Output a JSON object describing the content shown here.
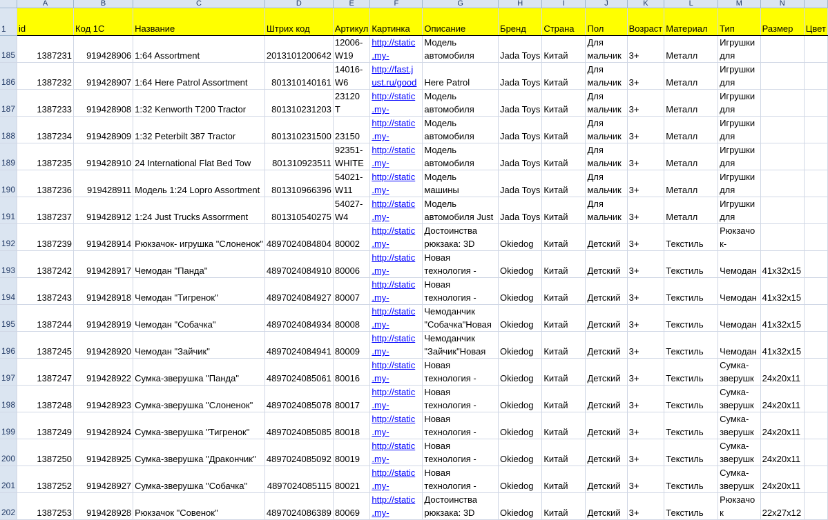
{
  "columns": [
    "A",
    "B",
    "C",
    "D",
    "E",
    "F",
    "G",
    "H",
    "I",
    "J",
    "K",
    "L",
    "M",
    "N"
  ],
  "header_row": {
    "row_number": "1",
    "cells": [
      "id",
      "Код 1С",
      "Название",
      "Штрих код",
      "Артикул",
      "Картинка",
      "Описание",
      "Бренд",
      "Страна",
      "Пол",
      "Возраст",
      "Материал",
      "Тип",
      "Размер",
      "Цвет"
    ]
  },
  "rows": [
    {
      "n": "185",
      "id": "1387231",
      "code": "919428906",
      "name": "1:64 Assortment",
      "barcode": "2013101200642",
      "art": [
        "12006-",
        "W19"
      ],
      "pic": [
        "http://static",
        ".my-"
      ],
      "desc": [
        "Модель",
        "автомобиля"
      ],
      "brand": "Jada Toys",
      "country": "Китай",
      "sex": [
        "Для",
        "мальчик"
      ],
      "age": "3+",
      "mat": "Металл",
      "type": [
        "Игрушки",
        "для"
      ],
      "size": ""
    },
    {
      "n": "186",
      "id": "1387232",
      "code": "919428907",
      "name": "1:64 Here Patrol Assortment",
      "barcode": "801310140161",
      "art": [
        "14016-",
        "W6"
      ],
      "pic": [
        "http://fast.j",
        "ust.ru/good"
      ],
      "desc": [
        "",
        "Here Patrol"
      ],
      "brand": "Jada Toys",
      "country": "Китай",
      "sex": [
        "Для",
        "мальчик"
      ],
      "age": "3+",
      "mat": "Металл",
      "type": [
        "Игрушки",
        "для"
      ],
      "size": ""
    },
    {
      "n": "187",
      "id": "1387233",
      "code": "919428908",
      "name": "1:32 Kenworth T200 Tractor",
      "barcode": "801310231203",
      "art": [
        "23120",
        "T"
      ],
      "pic": [
        "http://static",
        ".my-"
      ],
      "desc": [
        "Модель",
        "автомобиля"
      ],
      "brand": "Jada Toys",
      "country": "Китай",
      "sex": [
        "Для",
        "мальчик"
      ],
      "age": "3+",
      "mat": "Металл",
      "type": [
        "Игрушки",
        "для"
      ],
      "size": ""
    },
    {
      "n": "188",
      "id": "1387234",
      "code": "919428909",
      "name": "1:32 Peterbilt 387 Tractor",
      "barcode": "801310231500",
      "art": [
        "",
        "23150"
      ],
      "pic": [
        "http://static",
        ".my-"
      ],
      "desc": [
        "Модель",
        "автомобиля"
      ],
      "brand": "Jada Toys",
      "country": "Китай",
      "sex": [
        "Для",
        "мальчик"
      ],
      "age": "3+",
      "mat": "Металл",
      "type": [
        "Игрушки",
        "для"
      ],
      "size": ""
    },
    {
      "n": "189",
      "id": "1387235",
      "code": "919428910",
      "name": "24 International Flat Bed Tow",
      "barcode": "801310923511",
      "art": [
        "92351-",
        "WHITE"
      ],
      "pic": [
        "http://static",
        ".my-"
      ],
      "desc": [
        "Модель",
        "автомобиля"
      ],
      "brand": "Jada Toys",
      "country": "Китай",
      "sex": [
        "Для",
        "мальчик"
      ],
      "age": "3+",
      "mat": "Металл",
      "type": [
        "Игрушки",
        "для"
      ],
      "size": ""
    },
    {
      "n": "190",
      "id": "1387236",
      "code": "919428911",
      "name": "Модель  1:24 Lopro Assortment",
      "barcode": "801310966396",
      "art": [
        "54021-",
        "W11"
      ],
      "pic": [
        "http://static",
        ".my-"
      ],
      "desc": [
        "Модель",
        "машины"
      ],
      "brand": "Jada Toys",
      "country": "Китай",
      "sex": [
        "Для",
        "мальчик"
      ],
      "age": "3+",
      "mat": "Металл",
      "type": [
        "Игрушки",
        "для"
      ],
      "size": ""
    },
    {
      "n": "191",
      "id": "1387237",
      "code": "919428912",
      "name": "1:24 Just Trucks  Assorrment",
      "barcode": "801310540275",
      "art": [
        "54027-",
        "W4"
      ],
      "pic": [
        "http://static",
        ".my-"
      ],
      "desc": [
        "Модель",
        "автомобиля Just"
      ],
      "brand": "Jada Toys",
      "country": "Китай",
      "sex": [
        "Для",
        "мальчик"
      ],
      "age": "3+",
      "mat": "Металл",
      "type": [
        "Игрушки",
        "для"
      ],
      "size": ""
    },
    {
      "n": "192",
      "id": "1387239",
      "code": "919428914",
      "name": "Рюкзачок- игрушка \"Слоненок\"",
      "barcode": "4897024084804",
      "art": [
        "",
        "80002"
      ],
      "pic": [
        "http://static",
        ".my-"
      ],
      "desc": [
        "Достоинства",
        "рюкзака: 3D"
      ],
      "brand": "Okiedog",
      "country": "Китай",
      "sex": [
        "",
        "Детский"
      ],
      "age": "3+",
      "mat": "Текстиль",
      "type": [
        "Рюкзачо",
        "к-"
      ],
      "size": ""
    },
    {
      "n": "193",
      "id": "1387242",
      "code": "919428917",
      "name": "Чемодан \"Панда\"",
      "barcode": "4897024084910",
      "art": [
        "",
        "80006"
      ],
      "pic": [
        "http://static",
        ".my-"
      ],
      "desc": [
        "Новая",
        "технология -"
      ],
      "brand": "Okiedog",
      "country": "Китай",
      "sex": [
        "",
        "Детский"
      ],
      "age": "3+",
      "mat": "Текстиль",
      "type": [
        "",
        "Чемодан"
      ],
      "size": "41x32x15"
    },
    {
      "n": "194",
      "id": "1387243",
      "code": "919428918",
      "name": "Чемодан \"Тигренок\"",
      "barcode": "4897024084927",
      "art": [
        "",
        "80007"
      ],
      "pic": [
        "http://static",
        ".my-"
      ],
      "desc": [
        "Новая",
        "технология -"
      ],
      "brand": "Okiedog",
      "country": "Китай",
      "sex": [
        "",
        "Детский"
      ],
      "age": "3+",
      "mat": "Текстиль",
      "type": [
        "",
        "Чемодан"
      ],
      "size": "41x32x15"
    },
    {
      "n": "195",
      "id": "1387244",
      "code": "919428919",
      "name": "Чемодан \"Собачка\"",
      "barcode": "4897024084934",
      "art": [
        "",
        "80008"
      ],
      "pic": [
        "http://static",
        ".my-"
      ],
      "desc": [
        "Чемоданчик",
        "\"Собачка\"Новая"
      ],
      "brand": "Okiedog",
      "country": "Китай",
      "sex": [
        "",
        "Детский"
      ],
      "age": "3+",
      "mat": "Текстиль",
      "type": [
        "",
        "Чемодан"
      ],
      "size": "41x32x15"
    },
    {
      "n": "196",
      "id": "1387245",
      "code": "919428920",
      "name": "Чемодан \"Зайчик\"",
      "barcode": "4897024084941",
      "art": [
        "",
        "80009"
      ],
      "pic": [
        "http://static",
        ".my-"
      ],
      "desc": [
        "Чемоданчик",
        "\"Зайчик\"Новая"
      ],
      "brand": "Okiedog",
      "country": "Китай",
      "sex": [
        "",
        "Детский"
      ],
      "age": "3+",
      "mat": "Текстиль",
      "type": [
        "",
        "Чемодан"
      ],
      "size": "41x32x15"
    },
    {
      "n": "197",
      "id": "1387247",
      "code": "919428922",
      "name": "Сумка-зверушка \"Панда\"",
      "barcode": "4897024085061",
      "art": [
        "",
        "80016"
      ],
      "pic": [
        "http://static",
        ".my-"
      ],
      "desc": [
        "Новая",
        "технология -"
      ],
      "brand": "Okiedog",
      "country": "Китай",
      "sex": [
        "",
        "Детский"
      ],
      "age": "3+",
      "mat": "Текстиль",
      "type": [
        "Сумка-",
        "зверушк"
      ],
      "size": "24x20x11"
    },
    {
      "n": "198",
      "id": "1387248",
      "code": "919428923",
      "name": "Сумка-зверушка  \"Слоненок\"",
      "barcode": "4897024085078",
      "art": [
        "",
        "80017"
      ],
      "pic": [
        "http://static",
        ".my-"
      ],
      "desc": [
        "Новая",
        "технология -"
      ],
      "brand": "Okiedog",
      "country": "Китай",
      "sex": [
        "",
        "Детский"
      ],
      "age": "3+",
      "mat": "Текстиль",
      "type": [
        "Сумка-",
        "зверушк"
      ],
      "size": "24x20x11"
    },
    {
      "n": "199",
      "id": "1387249",
      "code": "919428924",
      "name": "Сумка-зверушка  \"Тигренок\"",
      "barcode": "4897024085085",
      "art": [
        "",
        "80018"
      ],
      "pic": [
        "http://static",
        ".my-"
      ],
      "desc": [
        "Новая",
        "технология -"
      ],
      "brand": "Okiedog",
      "country": "Китай",
      "sex": [
        "",
        "Детский"
      ],
      "age": "3+",
      "mat": "Текстиль",
      "type": [
        "Сумка-",
        "зверушк"
      ],
      "size": "24x20x11"
    },
    {
      "n": "200",
      "id": "1387250",
      "code": "919428925",
      "name": "Сумка-зверушка  \"Дракончик\"",
      "barcode": "4897024085092",
      "art": [
        "",
        "80019"
      ],
      "pic": [
        "http://static",
        ".my-"
      ],
      "desc": [
        "Новая",
        "технология -"
      ],
      "brand": "Okiedog",
      "country": "Китай",
      "sex": [
        "",
        "Детский"
      ],
      "age": "3+",
      "mat": "Текстиль",
      "type": [
        "Сумка-",
        "зверушк"
      ],
      "size": "24x20x11"
    },
    {
      "n": "201",
      "id": "1387252",
      "code": "919428927",
      "name": "Сумка-зверушка  \"Собачка\"",
      "barcode": "4897024085115",
      "art": [
        "",
        "80021"
      ],
      "pic": [
        "http://static",
        ".my-"
      ],
      "desc": [
        "Новая",
        "технология -"
      ],
      "brand": "Okiedog",
      "country": "Китай",
      "sex": [
        "",
        "Детский"
      ],
      "age": "3+",
      "mat": "Текстиль",
      "type": [
        "Сумка-",
        "зверушк"
      ],
      "size": "24x20x11"
    },
    {
      "n": "202",
      "id": "1387253",
      "code": "919428928",
      "name": "Рюкзачок \"Совенок\"",
      "barcode": "4897024086389",
      "art": [
        "",
        "80069"
      ],
      "pic": [
        "http://static",
        ".my-"
      ],
      "desc": [
        "Достоинства",
        "рюкзака: 3D"
      ],
      "brand": "Okiedog",
      "country": "Китай",
      "sex": [
        "",
        "Детский"
      ],
      "age": "3+",
      "mat": "Текстиль",
      "type": [
        "Рюкзачо",
        "к"
      ],
      "size": "22x27x12"
    }
  ]
}
